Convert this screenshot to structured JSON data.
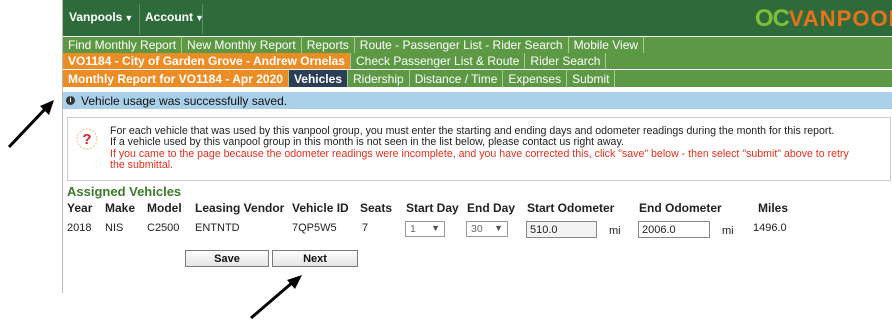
{
  "top_menu": {
    "vanpools": "Vanpools",
    "account": "Account"
  },
  "logo": {
    "oc": "OC",
    "vanpool": "VANPOOL"
  },
  "nav_row1": [
    "Find Monthly Report",
    "New Monthly Report",
    "Reports",
    "Route - Passenger List - Rider Search",
    "Mobile View"
  ],
  "nav_row2": {
    "crumb": "VO1184 - City of Garden Grove - Andrew Ornelas",
    "items": [
      "Check Passenger List & Route",
      "Rider Search"
    ]
  },
  "nav_row3": {
    "crumb": "Monthly Report for VO1184 - Apr 2020",
    "active": "Vehicles",
    "items": [
      "Ridership",
      "Distance / Time",
      "Expenses",
      "Submit"
    ]
  },
  "message": "Vehicle usage was successfully saved.",
  "help": {
    "line1": "For each vehicle that was used by this vanpool group, you must enter the starting and ending days and odometer readings during the month for this report.",
    "line2": "If a vehicle used by this vanpool group in this month is not seen in the list below, please contact us right away.",
    "line3": "If you came to the page because the odometer readings were incomplete, and you have corrected this, click \"save\" below - then select \"submit\" above to retry",
    "line4": "the submittal."
  },
  "section_title": "Assigned Vehicles",
  "table": {
    "headers": {
      "year": "Year",
      "make": "Make",
      "model": "Model",
      "vendor": "Leasing Vendor",
      "vehicle_id": "Vehicle ID",
      "seats": "Seats",
      "start_day": "Start Day",
      "end_day": "End Day",
      "start_odo": "Start Odometer",
      "end_odo": "End Odometer",
      "miles": "Miles"
    },
    "row": {
      "year": "2018",
      "make": "NIS",
      "model": "C2500",
      "vendor": "ENTNTD",
      "vehicle_id": "7QP5W5",
      "seats": "7",
      "start_day": "1",
      "end_day": "30",
      "start_odo": "510.0",
      "end_odo": "2006.0",
      "unit": "mi",
      "miles": "1496.0"
    }
  },
  "buttons": {
    "save": "Save",
    "next": "Next"
  },
  "colors": {
    "top_bar": "#2e6b3a",
    "nav_green": "#5d9945",
    "crumb_orange": "#ec8c25",
    "active_tab": "#2a3f57",
    "message_bg": "#aacfe9",
    "red_text": "#e0301e"
  }
}
